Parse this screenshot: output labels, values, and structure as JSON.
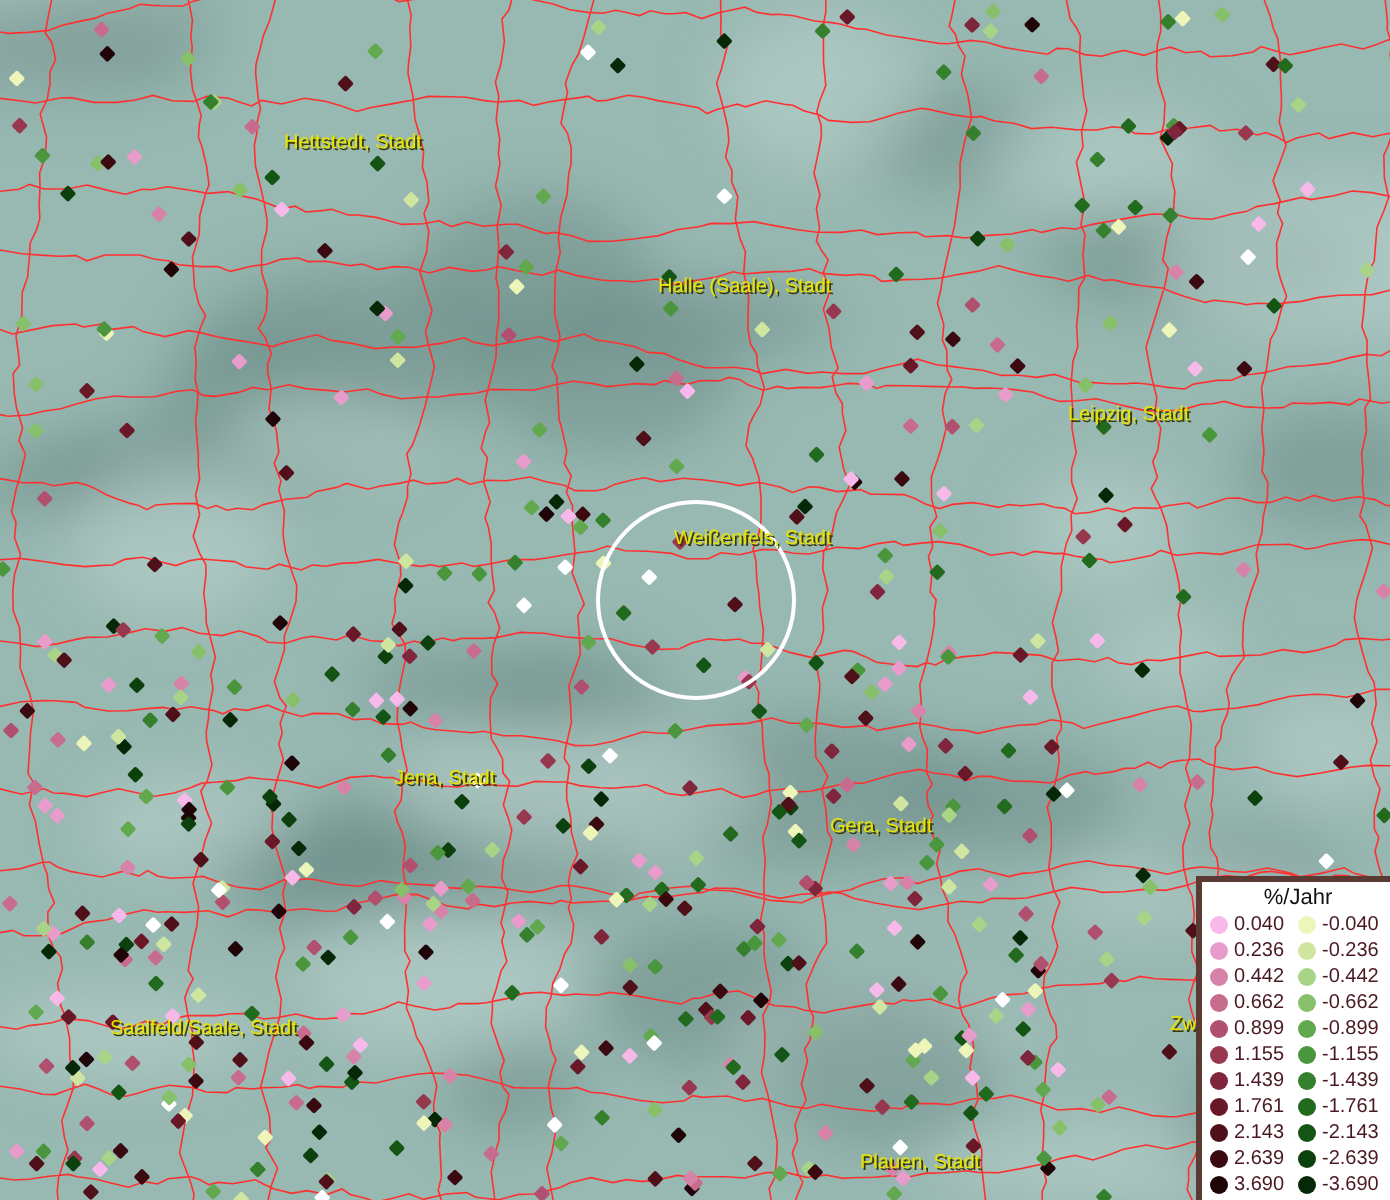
{
  "map": {
    "place_labels": [
      "Hettstedt, Stadt",
      "Halle (Saale), Stadt",
      "Leipzig, Stadt",
      "Weißenfels, Stadt",
      "Jena, Stadt",
      "Gera, Stadt",
      "Saalfeld/Saale, Stadt",
      "Plauen, Stadt",
      "Zw"
    ]
  },
  "legend": {
    "title": "%/Jahr",
    "rows": [
      {
        "left": {
          "label": "0.040",
          "color": "#f7b8ea"
        },
        "right": {
          "label": "-0.040",
          "color": "#eef5b8"
        }
      },
      {
        "left": {
          "label": "0.236",
          "color": "#e89ccb"
        },
        "right": {
          "label": "-0.236",
          "color": "#cfe6a0"
        }
      },
      {
        "left": {
          "label": "0.442",
          "color": "#d782a8"
        },
        "right": {
          "label": "-0.442",
          "color": "#a8d488"
        }
      },
      {
        "left": {
          "label": "0.662",
          "color": "#c86c8e"
        },
        "right": {
          "label": "-0.662",
          "color": "#86c068"
        }
      },
      {
        "left": {
          "label": "0.899",
          "color": "#b0506e"
        },
        "right": {
          "label": "-0.899",
          "color": "#62a84e"
        }
      },
      {
        "left": {
          "label": "1.155",
          "color": "#98384f"
        },
        "right": {
          "label": "-1.155",
          "color": "#4a963c"
        }
      },
      {
        "left": {
          "label": "1.439",
          "color": "#80263c"
        },
        "right": {
          "label": "-1.439",
          "color": "#34802c"
        }
      },
      {
        "left": {
          "label": "1.761",
          "color": "#6a1828"
        },
        "right": {
          "label": "-1.761",
          "color": "#226a1e"
        }
      },
      {
        "left": {
          "label": "2.143",
          "color": "#50101a"
        },
        "right": {
          "label": "-2.143",
          "color": "#145414"
        }
      },
      {
        "left": {
          "label": "2.639",
          "color": "#3a0a10"
        },
        "right": {
          "label": "-2.639",
          "color": "#0c400c"
        }
      },
      {
        "left": {
          "label": "3.690",
          "color": "#200508"
        },
        "right": {
          "label": "-3.690",
          "color": "#062806"
        }
      }
    ]
  }
}
